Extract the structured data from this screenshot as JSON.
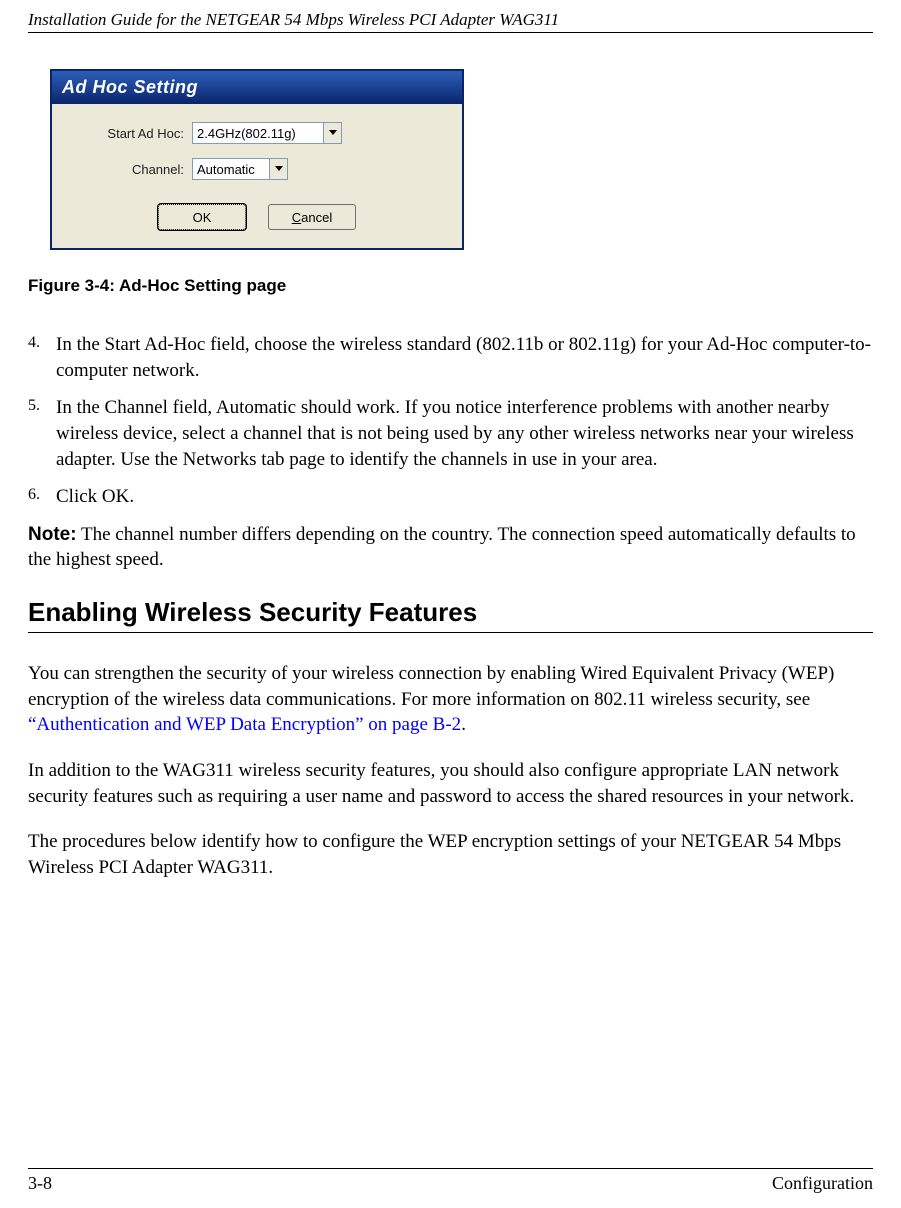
{
  "header": {
    "doc_title": "Installation Guide for the NETGEAR 54 Mbps Wireless PCI Adapter WAG311"
  },
  "dialog": {
    "title": "Ad Hoc Setting",
    "start_label": "Start Ad Hoc:",
    "start_value": "2.4GHz(802.11g)",
    "channel_label": "Channel:",
    "channel_value": "Automatic",
    "ok_label": "OK",
    "cancel_prefix": "C",
    "cancel_rest": "ancel"
  },
  "figure_caption": "Figure 3-4:  Ad-Hoc Setting page",
  "steps": [
    {
      "num": "4.",
      "text": "In the Start Ad-Hoc field, choose the wireless standard (802.11b or 802.11g) for your Ad-Hoc computer-to-computer network."
    },
    {
      "num": "5.",
      "text": "In the Channel field, Automatic should work. If you notice interference problems with another nearby wireless device, select a channel that is not being used by any other wireless networks near your wireless adapter. Use the Networks tab page to identify the channels in use in your area."
    },
    {
      "num": "6.",
      "text": "Click OK."
    }
  ],
  "note": {
    "label": "Note:",
    "text": " The channel number differs depending on the country. The connection speed automatically defaults to the highest speed."
  },
  "section_heading": "Enabling Wireless Security Features",
  "para1_a": "You can strengthen the security of your wireless connection by enabling Wired Equivalent Privacy (WEP) encryption of the wireless data communications. For more information on 802.11 wireless security, see ",
  "para1_link": "“Authentication and WEP Data Encryption” on page B-2",
  "para1_b": ".",
  "para2": "In addition to the WAG311 wireless security features, you should also configure appropriate LAN network security features such as requiring a user name and password to access the shared resources in your network.",
  "para3": "The procedures below identify how to configure the WEP encryption settings of your NETGEAR 54 Mbps Wireless PCI Adapter WAG311.",
  "footer": {
    "page": "3-8",
    "section": "Configuration"
  }
}
